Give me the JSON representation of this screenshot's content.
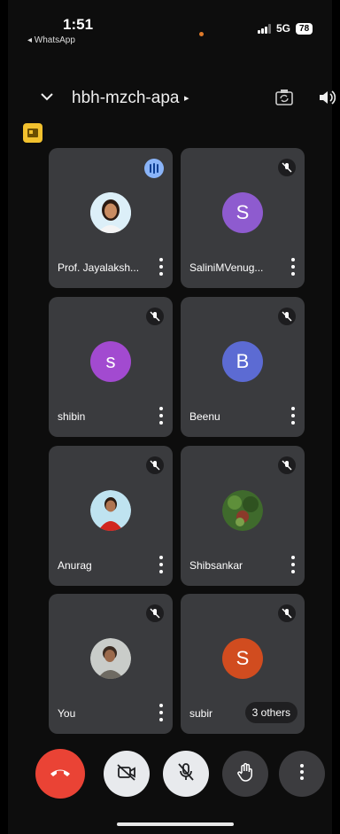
{
  "status_bar": {
    "time": "1:51",
    "back_app": "◂ WhatsApp",
    "network": "5G",
    "battery": "78"
  },
  "header": {
    "meeting_code": "hbh-mzch-apa",
    "arrow": "▸"
  },
  "participants": [
    {
      "name": "Prof. Jayalaksh...",
      "avatar_type": "photo",
      "status": "speaking"
    },
    {
      "name": "SaliniMVenug...",
      "avatar_type": "letter",
      "initial": "S",
      "color": "#8e5bcf",
      "status": "muted"
    },
    {
      "name": "shibin",
      "avatar_type": "letter",
      "initial": "s",
      "color": "#a24ad0",
      "status": "muted"
    },
    {
      "name": "Beenu",
      "avatar_type": "letter",
      "initial": "B",
      "color": "#5c6bd3",
      "status": "muted"
    },
    {
      "name": "Anurag",
      "avatar_type": "photo",
      "status": "muted"
    },
    {
      "name": "Shibsankar",
      "avatar_type": "photo",
      "status": "muted"
    },
    {
      "name": "You",
      "avatar_type": "photo",
      "status": "muted"
    },
    {
      "name": "subir",
      "avatar_type": "letter",
      "initial": "S",
      "color": "#d14c1f",
      "status": "muted",
      "extra": "3 others"
    }
  ],
  "controls": [
    "end-call-icon",
    "camera-off-icon",
    "mic-off-icon",
    "raise-hand-icon",
    "more-options-icon"
  ],
  "colors": {
    "end_call": "#ea4335",
    "tile": "#3a3b3e",
    "accent_badge": "#f2c12e"
  }
}
